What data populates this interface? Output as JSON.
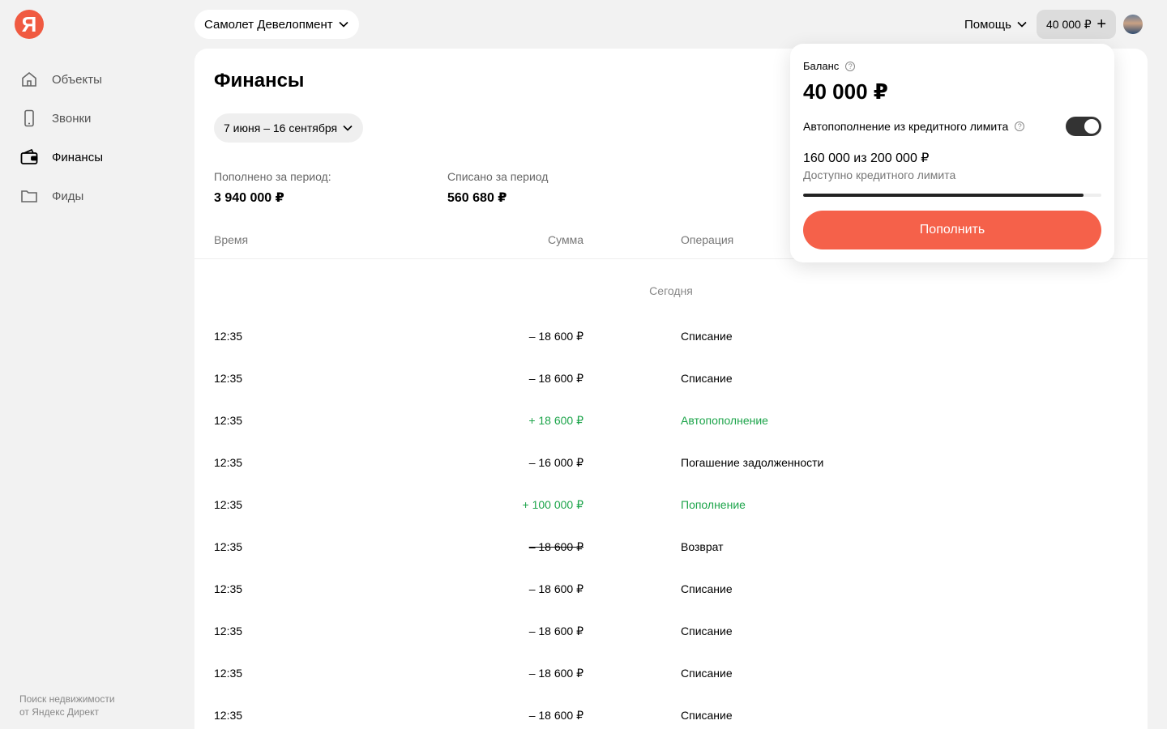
{
  "logo": {
    "letter": "Я"
  },
  "sidebar": {
    "items": [
      {
        "label": "Объекты",
        "icon": "house-icon",
        "active": false
      },
      {
        "label": "Звонки",
        "icon": "phone-icon",
        "active": false
      },
      {
        "label": "Финансы",
        "icon": "wallet-icon",
        "active": true
      },
      {
        "label": "Фиды",
        "icon": "folder-icon",
        "active": false
      }
    ],
    "footer": {
      "line1": "Поиск недвижимости",
      "line2": "от Яндекс Директ"
    }
  },
  "header": {
    "company": "Самолет Девелопмент",
    "help_label": "Помощь",
    "balance": "40 000 ₽",
    "balance_add": "+"
  },
  "main": {
    "title": "Финансы",
    "date_range": "7 июня – 16 сентября",
    "stats": {
      "topped_label": "Пополнено за период:",
      "topped_value": "3 940 000 ₽",
      "spent_label": "Списано за период",
      "spent_value": "560 680 ₽"
    },
    "columns": {
      "time": "Время",
      "sum": "Сумма",
      "operation": "Операция"
    },
    "group": "Сегодня",
    "rows": [
      {
        "time": "12:35",
        "sum": "– 18 600 ₽",
        "op": "Списание",
        "style": ""
      },
      {
        "time": "12:35",
        "sum": "– 18 600 ₽",
        "op": "Списание",
        "style": ""
      },
      {
        "time": "12:35",
        "sum": "+ 18 600 ₽",
        "op": "Автопополнение",
        "style": "green"
      },
      {
        "time": "12:35",
        "sum": "– 16 000 ₽",
        "op": "Погашение задолженности",
        "style": ""
      },
      {
        "time": "12:35",
        "sum": "+ 100 000 ₽",
        "op": "Пополнение",
        "style": "green"
      },
      {
        "time": "12:35",
        "sum": "– 18 600 ₽",
        "op": "Возврат",
        "style": "strike"
      },
      {
        "time": "12:35",
        "sum": "– 18 600 ₽",
        "op": "Списание",
        "style": ""
      },
      {
        "time": "12:35",
        "sum": "– 18 600 ₽",
        "op": "Списание",
        "style": ""
      },
      {
        "time": "12:35",
        "sum": "– 18 600 ₽",
        "op": "Списание",
        "style": ""
      },
      {
        "time": "12:35",
        "sum": "– 18 600 ₽",
        "op": "Списание",
        "style": ""
      }
    ]
  },
  "popup": {
    "balance_label": "Баланс",
    "balance_amount": "40 000 ₽",
    "auto_label": "Автопополнение из кредитного лимита",
    "auto_enabled": true,
    "limit_value": "160 000 из 200 000 ₽",
    "limit_caption": "Доступно кредитного лимита",
    "limit_fraction": 0.94,
    "topup_label": "Пополнить",
    "help_glyph": "?"
  },
  "colors": {
    "accent": "#f5614a",
    "positive": "#1ca44a"
  }
}
